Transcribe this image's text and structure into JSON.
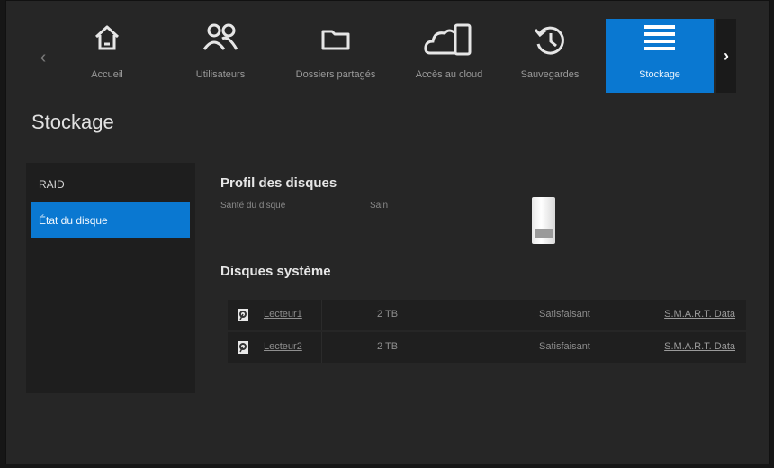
{
  "nav": {
    "tabs": [
      {
        "label": "Accueil",
        "icon": "home-icon"
      },
      {
        "label": "Utilisateurs",
        "icon": "users-icon"
      },
      {
        "label": "Dossiers partagés",
        "icon": "folder-icon"
      },
      {
        "label": "Accès au cloud",
        "icon": "cloud-device-icon"
      },
      {
        "label": "Sauvegardes",
        "icon": "history-icon"
      },
      {
        "label": "Stockage",
        "icon": "storage-menu-icon",
        "active": true
      }
    ],
    "prev_glyph": "‹",
    "next_glyph": "›"
  },
  "page": {
    "title": "Stockage"
  },
  "sidebar": {
    "items": [
      {
        "label": "RAID",
        "active": false
      },
      {
        "label": "État du disque",
        "active": true
      }
    ]
  },
  "profile": {
    "title": "Profil des disques",
    "health_label": "Santé du disque",
    "health_value": "Sain"
  },
  "system_disks": {
    "title": "Disques système",
    "rows": [
      {
        "name": "Lecteur1",
        "size": "2 TB",
        "status": "Satisfaisant",
        "link": "S.M.A.R.T. Data"
      },
      {
        "name": "Lecteur2",
        "size": "2 TB",
        "status": "Satisfaisant",
        "link": "S.M.A.R.T. Data"
      }
    ]
  },
  "colors": {
    "accent": "#0a78d1",
    "background": "#262626"
  }
}
